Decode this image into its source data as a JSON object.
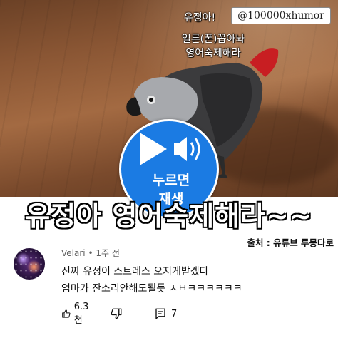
{
  "video": {
    "watermark": "@100000xhumor",
    "captions": [
      "유정아!",
      "얼른(폰)꼽아놔",
      "영어숙제해라"
    ]
  },
  "play_badge": {
    "line1": "누르면",
    "line2": "재생",
    "icons": [
      "play-icon",
      "speaker-icon"
    ]
  },
  "subtitle": "유정아 영어숙제해라~~",
  "source": "출처 : 유튜브 루몽다로",
  "comment": {
    "author": "Velari",
    "separator": "•",
    "time": "1주 전",
    "lines": [
      "진짜 유정이 스트레스 오지게받겠다",
      "엄마가 잔소리안해도될듯 ㅅㅂㅋㅋㅋㅋㅋㅋ"
    ],
    "likes": "6.3천",
    "replies": "7",
    "icons": [
      "thumbs-up-icon",
      "thumbs-down-icon",
      "comment-icon"
    ]
  },
  "colors": {
    "badge": "#1b7be3",
    "text": "#0f0f0f",
    "meta": "#606060"
  }
}
